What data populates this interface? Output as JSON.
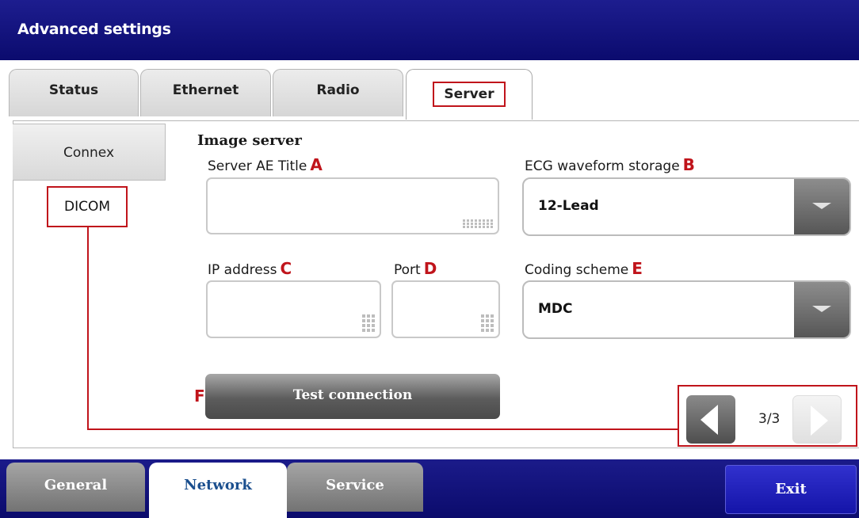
{
  "window": {
    "title": "Advanced settings"
  },
  "top_tabs": [
    {
      "label": "Status"
    },
    {
      "label": "Ethernet"
    },
    {
      "label": "Radio"
    },
    {
      "label": "Server"
    }
  ],
  "side_tabs": [
    {
      "label": "Connex"
    },
    {
      "label": "DICOM"
    }
  ],
  "form": {
    "section_title": "Image server",
    "server_ae_title": {
      "label": "Server AE Title",
      "marker": "A",
      "value": ""
    },
    "ecg_waveform_storage": {
      "label": "ECG waveform storage",
      "marker": "B",
      "value": "12-Lead"
    },
    "ip_address": {
      "label": "IP address",
      "marker": "C",
      "value": ""
    },
    "port": {
      "label": "Port",
      "marker": "D",
      "value": ""
    },
    "coding_scheme": {
      "label": "Coding scheme",
      "marker": "E",
      "value": "MDC"
    },
    "test_connection": {
      "label": "Test connection",
      "marker": "F"
    }
  },
  "pager": {
    "text": "3/3"
  },
  "bottom_tabs": [
    {
      "label": "General"
    },
    {
      "label": "Network"
    },
    {
      "label": "Service"
    }
  ],
  "exit_label": "Exit",
  "colors": {
    "title_bar": "#0b0b6e",
    "annotation_red": "#c0141b",
    "exit_button": "#1414a8",
    "active_bottom_tab_text": "#1b4f8e"
  }
}
